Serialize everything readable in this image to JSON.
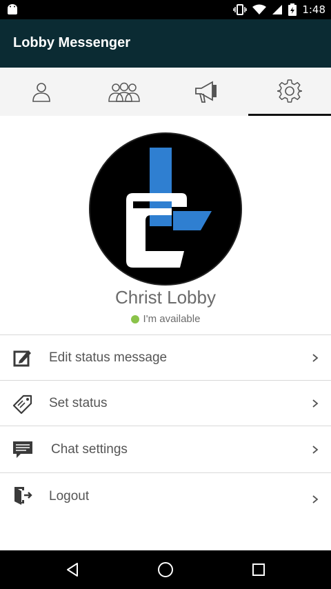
{
  "status_bar": {
    "time": "1:48",
    "icons": [
      "android-icon",
      "vibrate-icon",
      "wifi-icon",
      "signal-icon",
      "battery-icon"
    ]
  },
  "app_bar": {
    "title": "Lobby Messenger"
  },
  "tabs": [
    {
      "icon": "person-icon",
      "active": false
    },
    {
      "icon": "group-icon",
      "active": false
    },
    {
      "icon": "megaphone-icon",
      "active": false
    },
    {
      "icon": "settings-gear-icon",
      "active": true
    }
  ],
  "profile": {
    "name": "Christ Lobby",
    "status_text": "I'm available",
    "status_color": "#8bc34a"
  },
  "menu": [
    {
      "label": "Edit status message",
      "icon": "edit-icon"
    },
    {
      "label": "Set status",
      "icon": "tag-icon"
    },
    {
      "label": "Chat settings",
      "icon": "chat-icon"
    },
    {
      "label": "Logout",
      "icon": "logout-icon"
    }
  ],
  "colors": {
    "app_bar": "#0b2b33",
    "accent_blue": "#2f7fd1",
    "text_gray": "#6b6b6b"
  }
}
